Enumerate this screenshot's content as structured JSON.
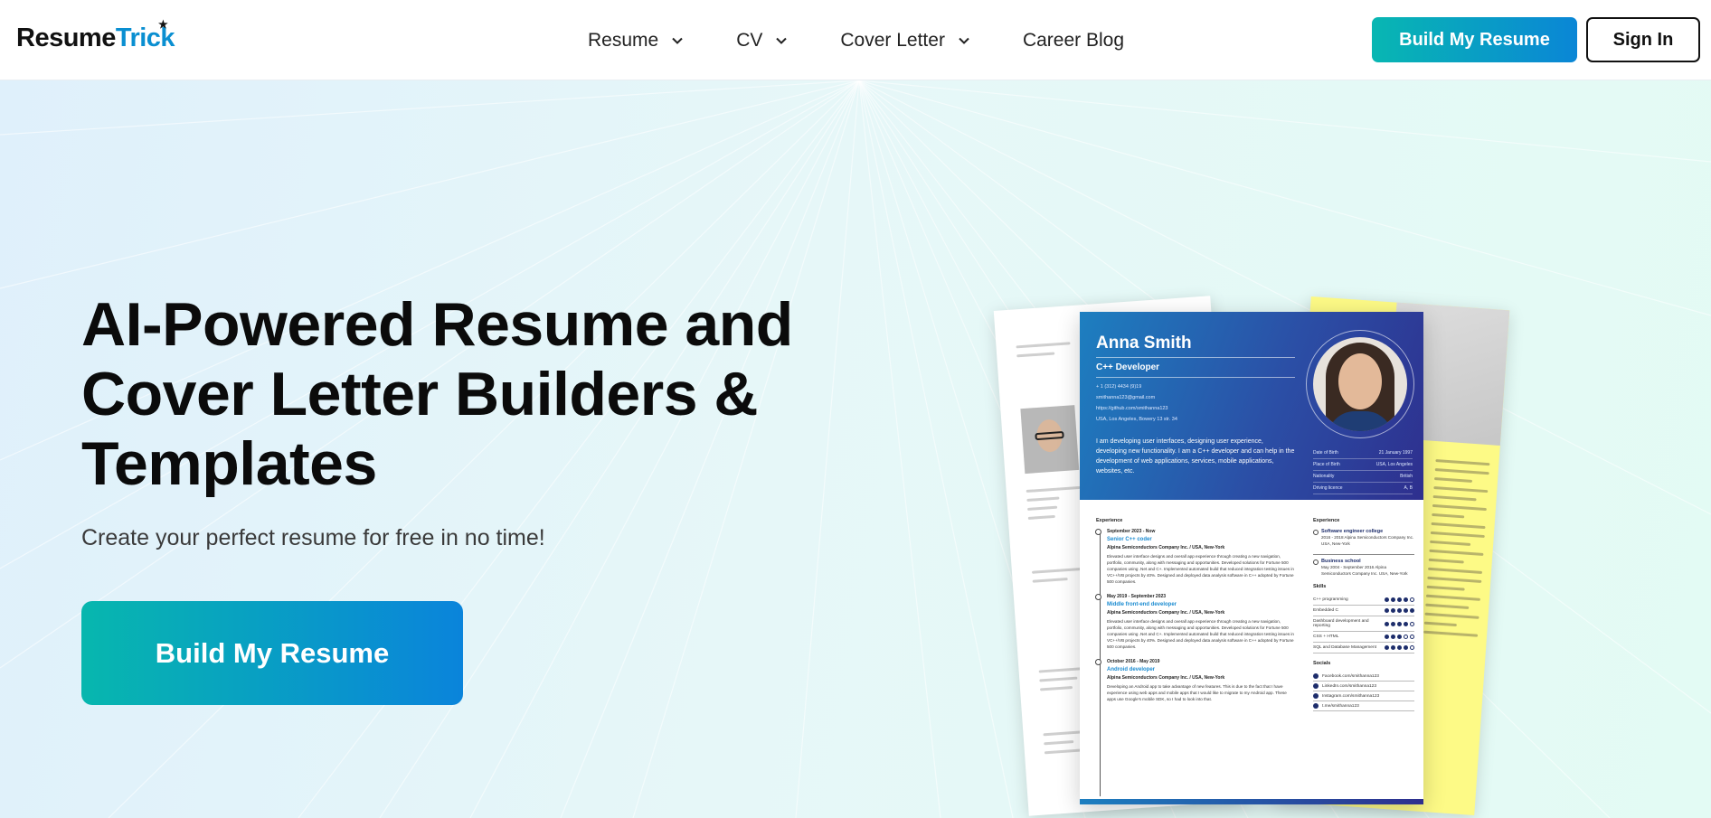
{
  "header": {
    "logo": {
      "part1": "Resume",
      "part2": "Tr",
      "part3": "i",
      "part4": "ck"
    },
    "nav": [
      {
        "label": "Resume",
        "has_dropdown": true
      },
      {
        "label": "CV",
        "has_dropdown": true
      },
      {
        "label": "Cover Letter",
        "has_dropdown": true
      },
      {
        "label": "Career Blog",
        "has_dropdown": false
      }
    ],
    "build_button": "Build My Resume",
    "signin_button": "Sign In"
  },
  "hero": {
    "title_line1": "AI-Powered Resume and",
    "title_line2": "Cover Letter Builders &",
    "title_line3": "Templates",
    "subtitle": "Create your perfect resume for free in no time!",
    "cta": "Build My Resume"
  },
  "resume_preview": {
    "name": "Anna Smith",
    "role": "C++ Developer",
    "contacts": [
      "+ 1 (312) 4434 (9)19",
      "smithanna123@gmail.com",
      "https://github.com/smithanna123",
      "USA, Los Angeles, Bowery 13 str. 34"
    ],
    "about": "I am developing user interfaces, designing user experience, developing new functionality. I am a C++ developer and can help in the development of web applications, services, mobile applications, websites, etc.",
    "facts": [
      {
        "k": "Date of Birth",
        "v": "21 January 1997"
      },
      {
        "k": "Place of Birth",
        "v": "USA, Los Angeles"
      },
      {
        "k": "Nationality",
        "v": "British"
      },
      {
        "k": "Driving licence",
        "v": "A, B"
      }
    ],
    "experience_title": "Experience",
    "jobs": [
      {
        "date": "September 2023 - Now",
        "title": "Senior C++ coder",
        "company": "Alpina Semiconductors Company Inc.  /  USA, New-York",
        "text": "Elevated user interface designs and overall app experience through creating a new navigation, portfolio, community, along with messaging and opportunities. Developed solutions for Fortune 500 companies using .Net and C+. Implemented automated build that reduced integration testing issues in VC++/VB projects by 40%. Designed and deployed data analysis software in C++ adopted by Fortune 500 companies."
      },
      {
        "date": "May 2019 - September 2023",
        "title": "Middle front-end developer",
        "company": "Alpina Semiconductors Company Inc.  /  USA, New-York",
        "text": "Elevated user interface designs and overall app experience through creating a new navigation, portfolio, community, along with messaging and opportunities. Developed solutions for Fortune 500 companies using .Net and C+. Implemented automated build that reduced integration testing issues in VC++/VB projects by 40%. Designed and deployed data analysis software in C++ adopted by Fortune 500 companies."
      },
      {
        "date": "October 2016 - May 2019",
        "title": "Android developer",
        "company": "Alpina Semiconductors Company Inc.  /  USA, New-York",
        "text": "Developing an Android app to take advantage of new features. This is due to the fact that I have experience using web apps and mobile apps that I would like to migrate to my Android app. These apps use Google's mobile SDK, so I had to look into that."
      }
    ],
    "education_title": "Experience",
    "education": [
      {
        "title": "Software engineer college",
        "sub": "2016 - 2018  Alpina Semiconductors Company Inc.  USA, New-York"
      },
      {
        "title": "Business school",
        "sub": "May 2004 - September 2016  Alpina Semiconductors Company Inc.  USA, New-York"
      }
    ],
    "skills_title": "Skills",
    "skills": [
      {
        "name": "C++ programming",
        "level": 4
      },
      {
        "name": "Embedded C",
        "level": 5
      },
      {
        "name": "Dashboard development and reporting",
        "level": 4
      },
      {
        "name": "CSS + HTML",
        "level": 3
      },
      {
        "name": "SQL and Database Management",
        "level": 4
      }
    ],
    "socials_title": "Socials",
    "socials": [
      "Facebook.com/smithanna123",
      "LinkedIn.com/smithanna123",
      "Instagram.com/smithanna123",
      "t.me/smithanna123"
    ]
  },
  "colors": {
    "accent_start": "#08b7b2",
    "accent_end": "#0a86d6",
    "resume_header": "#2b4fa6"
  }
}
